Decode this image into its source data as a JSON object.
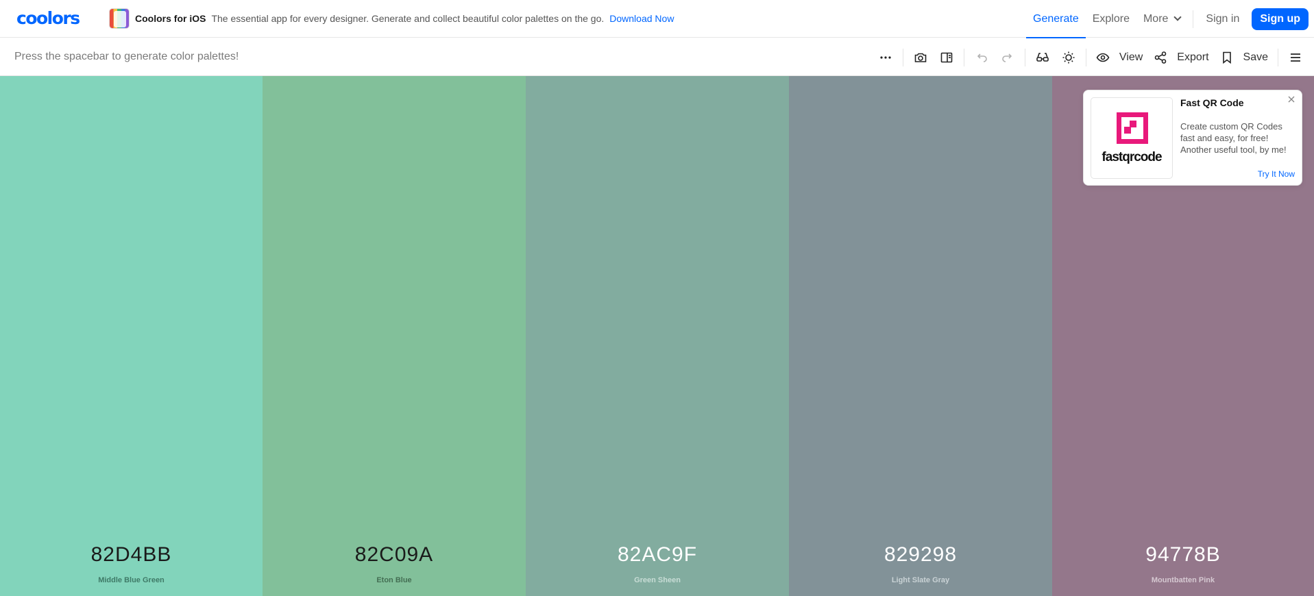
{
  "brand": {
    "logo_text": "coolors"
  },
  "promo": {
    "title": "Coolors for iOS",
    "description": "The essential app for every designer. Generate and collect beautiful color palettes on the go.",
    "link": "Download Now"
  },
  "nav": {
    "generate": "Generate",
    "explore": "Explore",
    "more": "More",
    "sign_in": "Sign in",
    "sign_up": "Sign up",
    "accent_color": "#0066ff"
  },
  "toolbar": {
    "hint": "Press the spacebar to generate color palettes!",
    "view_label": "View",
    "export_label": "Export",
    "save_label": "Save",
    "icons": [
      "more-options-icon",
      "camera-icon",
      "sidebar-icon",
      "undo-icon",
      "redo-icon",
      "glasses-icon",
      "sun-icon",
      "eye-icon",
      "share-icon",
      "bookmark-icon",
      "hamburger-menu-icon"
    ]
  },
  "palette": [
    {
      "hex": "82D4BB",
      "name": "Middle Blue Green",
      "color": "#82D4BB",
      "text_color": "#1a1a1a",
      "name_color": "#3f7a67"
    },
    {
      "hex": "82C09A",
      "name": "Eton Blue",
      "color": "#82C09A",
      "text_color": "#1a1a1a",
      "name_color": "#446e53"
    },
    {
      "hex": "82AC9F",
      "name": "Green Sheen",
      "color": "#82AC9F",
      "text_color": "#ffffff",
      "name_color": "#c8ddd6"
    },
    {
      "hex": "829298",
      "name": "Light Slate Gray",
      "color": "#829298",
      "text_color": "#ffffff",
      "name_color": "#c9d2d5"
    },
    {
      "hex": "94778B",
      "name": "Mountbatten Pink",
      "color": "#94778B",
      "text_color": "#ffffff",
      "name_color": "#d6c9d2"
    }
  ],
  "ad": {
    "title": "Fast QR Code",
    "body": "Create custom QR Codes fast and easy, for free! Another useful tool, by me!",
    "cta": "Try It Now",
    "logo_text": "fastqrcode",
    "logo_color": "#e8197b"
  }
}
